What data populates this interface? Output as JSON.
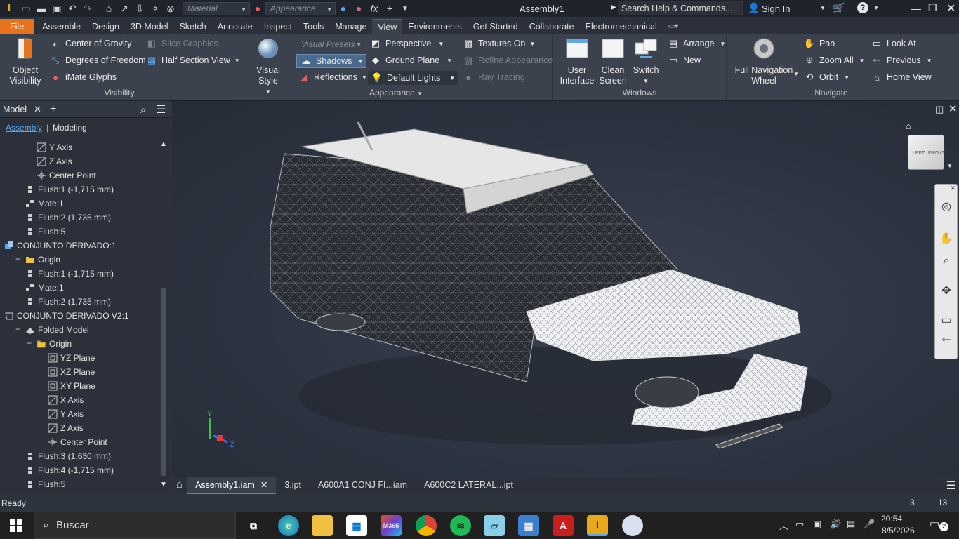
{
  "window": {
    "title": "Assembly1",
    "search_placeholder": "Search Help & Commands...",
    "sign_in": "Sign In",
    "material_combo": "Material",
    "appearance_combo": "Appearance"
  },
  "ribbon_tabs": [
    "File",
    "Assemble",
    "Design",
    "3D Model",
    "Sketch",
    "Annotate",
    "Inspect",
    "Tools",
    "Manage",
    "View",
    "Environments",
    "Get Started",
    "Collaborate",
    "Electromechanical"
  ],
  "ribbon": {
    "visibility": {
      "label": "Visibility",
      "object_visibility": "Object\nVisibility",
      "object_visibility_l1": "Object",
      "object_visibility_l2": "Visibility",
      "center_of_gravity": "Center of Gravity",
      "degrees_of_freedom": "Degrees of Freedom",
      "imate_glyphs": "iMate Glyphs",
      "slice_graphics": "Slice Graphics",
      "half_section_view": "Half Section View"
    },
    "appearance": {
      "label": "Appearance",
      "visual_style": "Visual Style",
      "visual_presets": "Visual Presets",
      "shadows": "Shadows",
      "reflections": "Reflections",
      "perspective": "Perspective",
      "ground_plane": "Ground Plane",
      "default_lights": "Default Lights",
      "textures_on": "Textures On",
      "refine_appearance": "Refine Appearance",
      "ray_tracing": "Ray Tracing"
    },
    "windows": {
      "label": "Windows",
      "user_interface_l1": "User",
      "user_interface_l2": "Interface",
      "clean_screen_l1": "Clean",
      "clean_screen_l2": "Screen",
      "switch": "Switch",
      "arrange": "Arrange",
      "new": "New"
    },
    "navigate": {
      "label": "Navigate",
      "full_nav_l1": "Full Navigation",
      "full_nav_l2": "Wheel",
      "pan": "Pan",
      "zoom_all": "Zoom All",
      "orbit": "Orbit",
      "look_at": "Look At",
      "previous": "Previous",
      "home_view": "Home View"
    }
  },
  "browser": {
    "tab_label": "Model",
    "subtab_assembly": "Assembly",
    "subtab_modeling": "Modeling",
    "tree": [
      {
        "label": "Y Axis",
        "indent": 2,
        "icon": "axis"
      },
      {
        "label": "Z Axis",
        "indent": 2,
        "icon": "axis"
      },
      {
        "label": "Center Point",
        "indent": 2,
        "icon": "point"
      },
      {
        "label": "Flush:1 (-1,715 mm)",
        "indent": 1,
        "icon": "flush"
      },
      {
        "label": "Mate:1",
        "indent": 1,
        "icon": "mate"
      },
      {
        "label": "Flush:2 (1,735 mm)",
        "indent": 1,
        "icon": "flush"
      },
      {
        "label": "Flush:5",
        "indent": 1,
        "icon": "flush"
      },
      {
        "label": "CONJUNTO DERIVADO:1",
        "indent": 0,
        "icon": "assembly",
        "expander": "−"
      },
      {
        "label": "Origin",
        "indent": 1,
        "icon": "folder",
        "expander": "+"
      },
      {
        "label": "Flush:1 (-1,715 mm)",
        "indent": 1,
        "icon": "flush"
      },
      {
        "label": "Mate:1",
        "indent": 1,
        "icon": "mate"
      },
      {
        "label": "Flush:2 (1,735 mm)",
        "indent": 1,
        "icon": "flush"
      },
      {
        "label": "CONJUNTO DERIVADO V2:1",
        "indent": 0,
        "icon": "part",
        "expander": "−"
      },
      {
        "label": "Folded Model",
        "indent": 1,
        "icon": "folded",
        "expander": "−"
      },
      {
        "label": "Origin",
        "indent": 2,
        "icon": "folder-open",
        "expander": "−"
      },
      {
        "label": "YZ Plane",
        "indent": 3,
        "icon": "plane"
      },
      {
        "label": "XZ Plane",
        "indent": 3,
        "icon": "plane"
      },
      {
        "label": "XY Plane",
        "indent": 3,
        "icon": "plane"
      },
      {
        "label": "X Axis",
        "indent": 3,
        "icon": "axis"
      },
      {
        "label": "Y Axis",
        "indent": 3,
        "icon": "axis"
      },
      {
        "label": "Z Axis",
        "indent": 3,
        "icon": "axis"
      },
      {
        "label": "Center Point",
        "indent": 3,
        "icon": "point"
      },
      {
        "label": "Flush:3 (1,630 mm)",
        "indent": 1,
        "icon": "flush"
      },
      {
        "label": "Flush:4 (-1,715 mm)",
        "indent": 1,
        "icon": "flush"
      },
      {
        "label": "Flush:5",
        "indent": 1,
        "icon": "flush"
      }
    ]
  },
  "viewcube": {
    "left": "LEFT",
    "front": "FRONT"
  },
  "axis_triad": {
    "y": "Y",
    "z": "Z"
  },
  "doc_tabs": [
    "Assembly1.iam",
    "3.ipt",
    "A600A1 CONJ FI...iam",
    "A600C2 LATERAL...ipt"
  ],
  "status": {
    "text": "Ready",
    "count1": "3",
    "count2": "13"
  },
  "taskbar": {
    "search_placeholder": "Buscar",
    "time": "20:54",
    "date": "8/5/2026",
    "notifications": "2"
  },
  "colors": {
    "accent": "#e8731c",
    "active_tab": "#3d8fd6",
    "viewport": "#2c3340"
  }
}
